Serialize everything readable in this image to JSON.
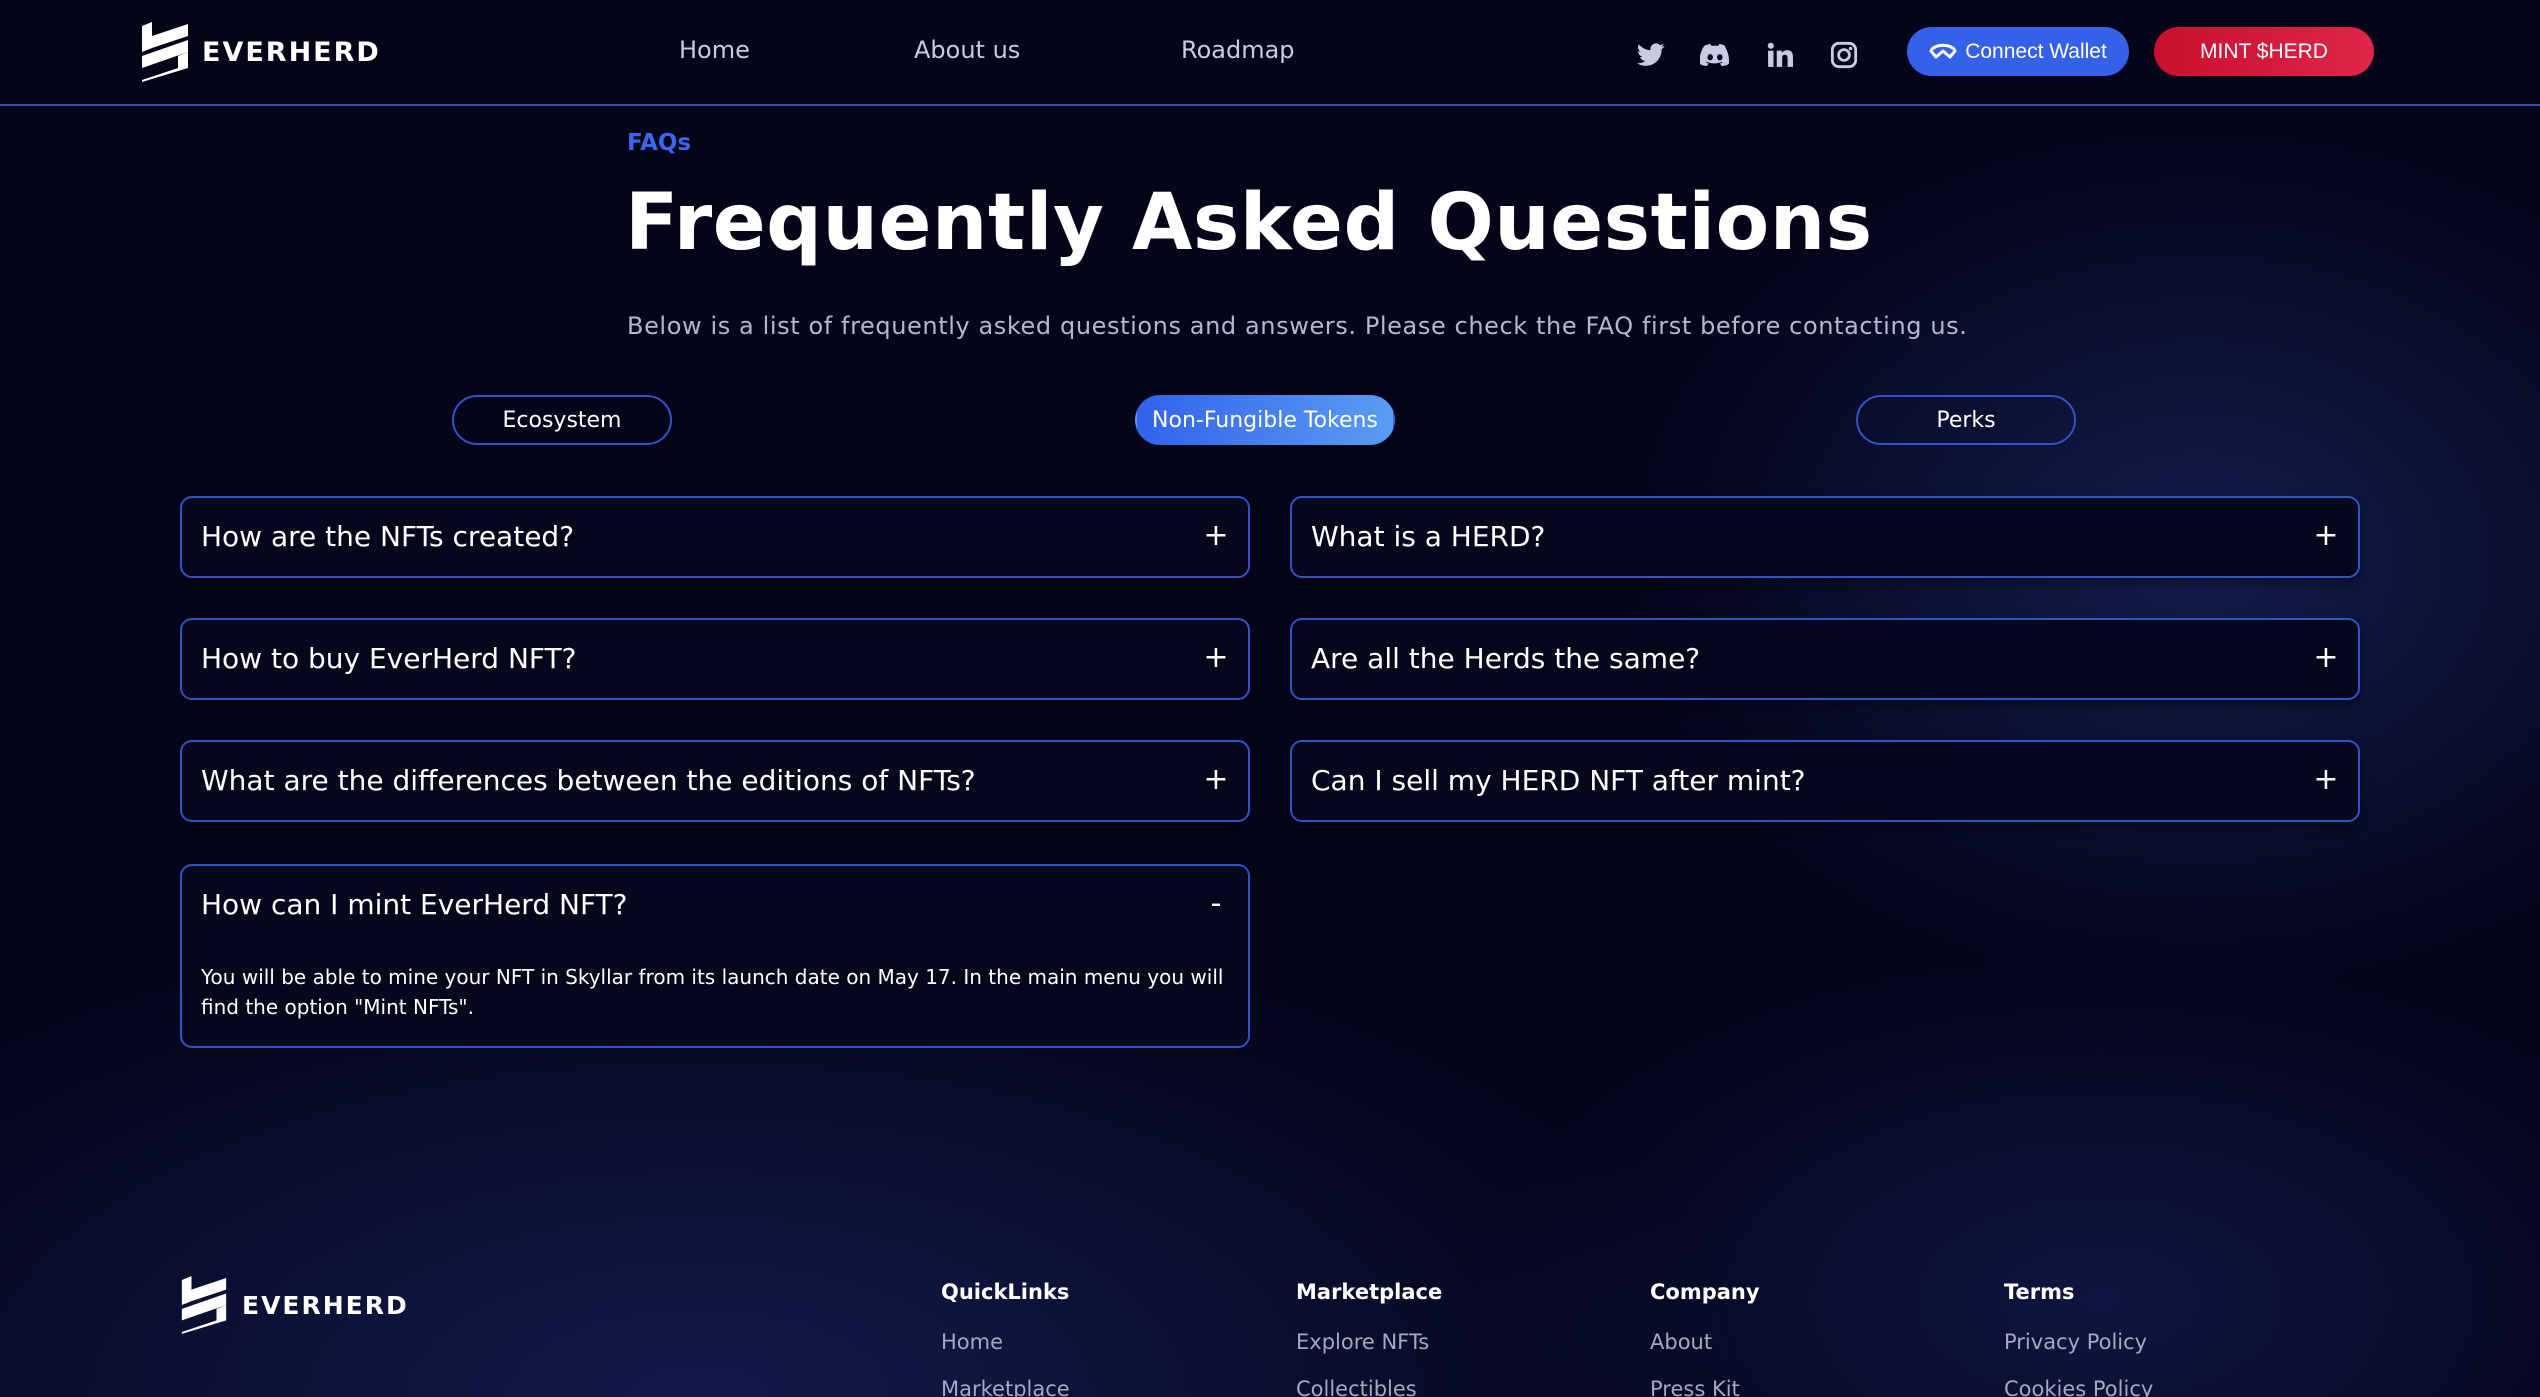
{
  "brand": {
    "name": "EVERHERD"
  },
  "nav": {
    "items": [
      {
        "label": "Home"
      },
      {
        "label": "About us"
      },
      {
        "label": "Roadmap"
      }
    ]
  },
  "socials": [
    "twitter-icon",
    "discord-icon",
    "linkedin-icon",
    "instagram-icon"
  ],
  "header_actions": {
    "connect_label": "Connect Wallet",
    "mint_label": "MINT $HERD"
  },
  "faq": {
    "eyebrow": "FAQs",
    "title": "Frequently Asked Questions",
    "subtitle": "Below is a list of frequently asked questions and answers. Please check the FAQ first before contacting us.",
    "tabs": [
      {
        "label": "Ecosystem",
        "active": false
      },
      {
        "label": "Non-Fungible Tokens",
        "active": true
      },
      {
        "label": "Perks",
        "active": false
      }
    ],
    "left": [
      {
        "question": "How are the NFTs created?",
        "sign": "+"
      },
      {
        "question": "How to buy EverHerd NFT?",
        "sign": "+"
      },
      {
        "question": "What are the differences between the editions of NFTs?",
        "sign": "+"
      },
      {
        "question": "How can I mint EverHerd NFT?",
        "sign": "-",
        "answer_line1": "You will be able to mine your NFT in Skyllar from its launch date on May 17. In the main menu you will",
        "answer_line2": "find the option \"Mint NFTs\"."
      }
    ],
    "right": [
      {
        "question": "What is a HERD?",
        "sign": "+"
      },
      {
        "question": "Are all the Herds the same?",
        "sign": "+"
      },
      {
        "question": "Can I sell my HERD NFT after mint?",
        "sign": "+"
      }
    ]
  },
  "footer": {
    "brand": "EVERHERD",
    "columns": [
      {
        "title": "QuickLinks",
        "links": [
          "Home",
          "Marketplace"
        ]
      },
      {
        "title": "Marketplace",
        "links": [
          "Explore NFTs",
          "Collectibles"
        ]
      },
      {
        "title": "Company",
        "links": [
          "About",
          "Press Kit"
        ]
      },
      {
        "title": "Terms",
        "links": [
          "Privacy Policy",
          "Cookies Policy"
        ]
      }
    ]
  },
  "colors": {
    "accent": "#3461e8",
    "mint": "#d81b3c",
    "background": "#05051a",
    "border": "#2f53c8"
  }
}
